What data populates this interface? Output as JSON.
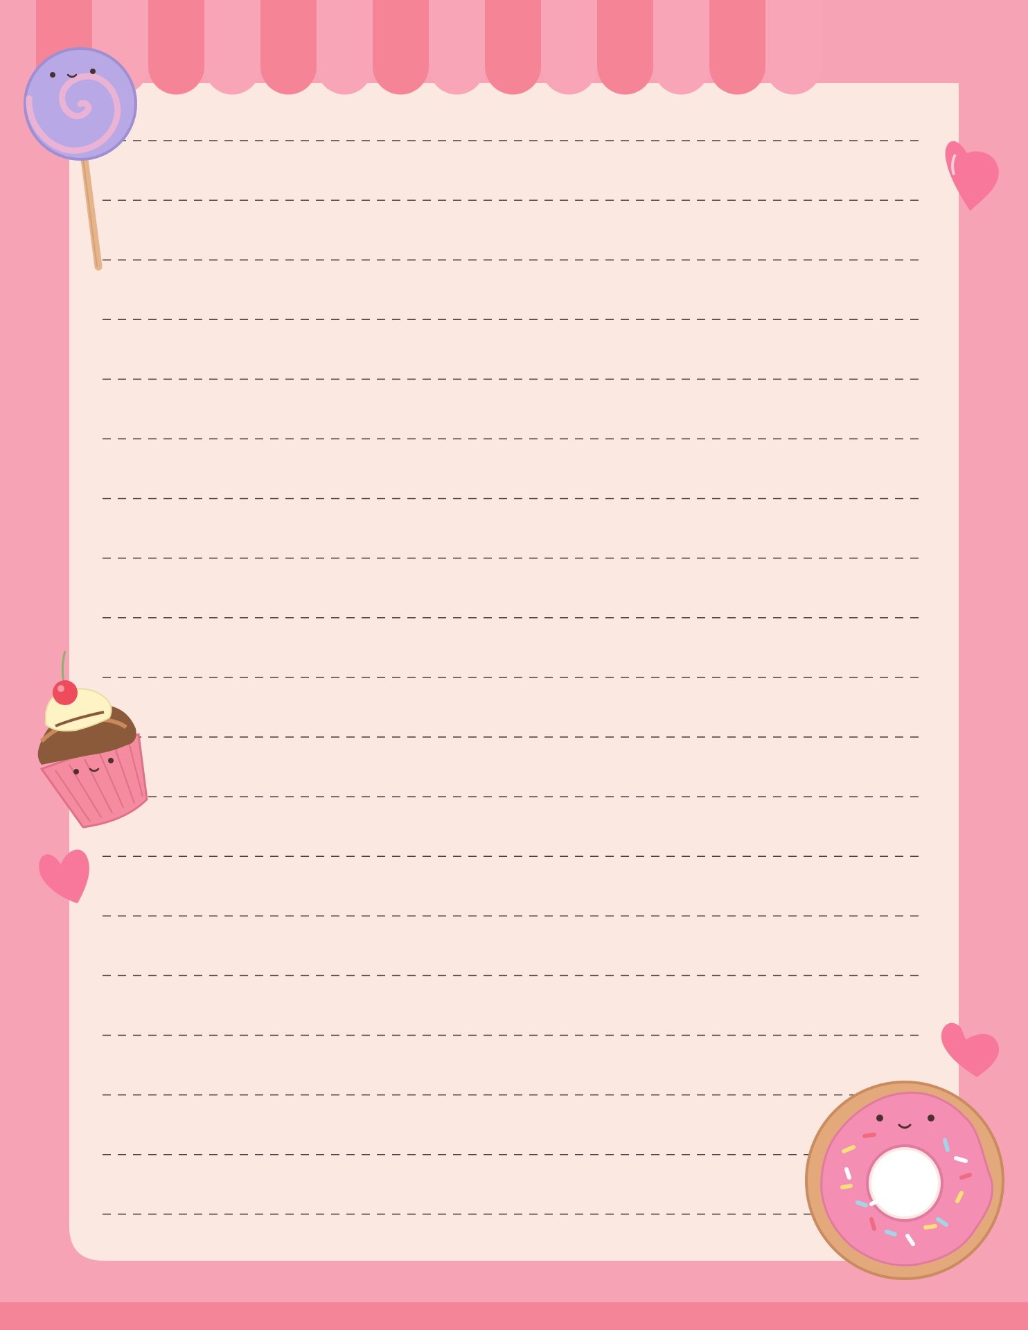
{
  "page": {
    "title": "",
    "line_count": 19
  },
  "colors": {
    "border_pink": "#f7a3b6",
    "stripe_dark": "#f48496",
    "stripe_light": "#f8a5b7",
    "paper": "#fbe8e1",
    "bottom_band": "#f48598",
    "dashed_line": "#4a3a3a",
    "heart_pink": "#f7789a",
    "lollipop_purple": "#b09ee0",
    "lollipop_pink": "#e8a5c8",
    "donut_dough": "#e3a97b",
    "donut_icing": "#f58eb3",
    "cupcake_liner": "#f48b9e",
    "cupcake_cream": "#fdf3c5",
    "chocolate": "#8a5a3b",
    "cherry": "#ee4b5c"
  },
  "decorations": [
    {
      "name": "lollipop-icon"
    },
    {
      "name": "heart-icon"
    },
    {
      "name": "cupcake-icon"
    },
    {
      "name": "donut-icon"
    }
  ]
}
